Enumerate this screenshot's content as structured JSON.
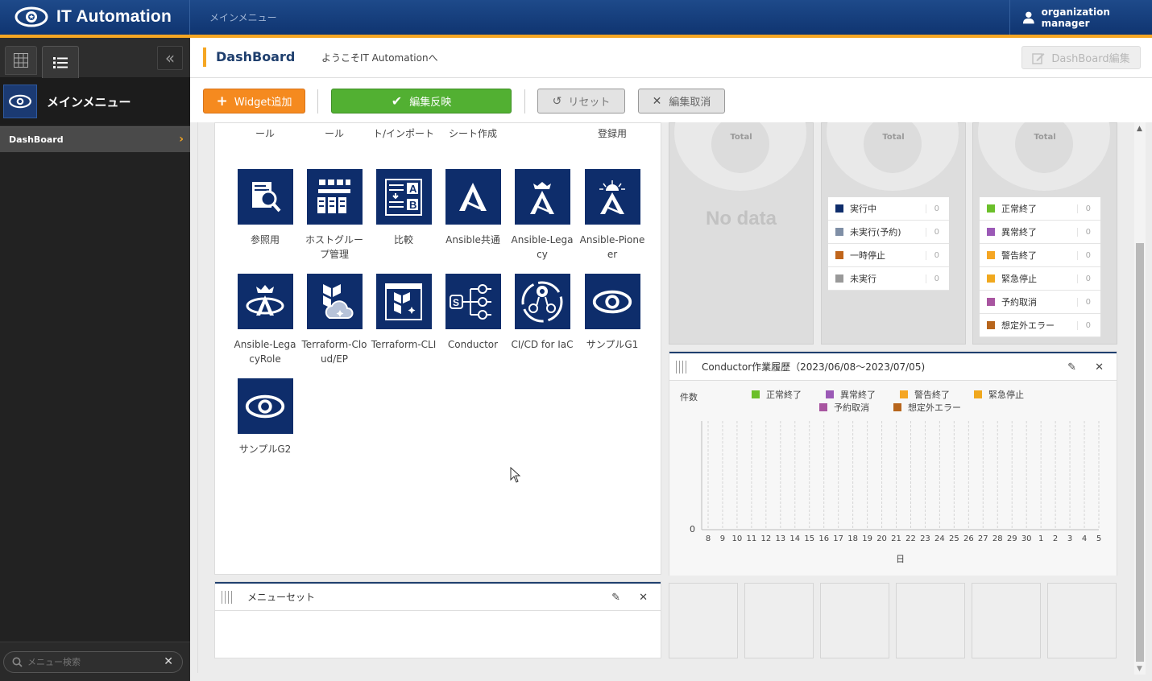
{
  "header": {
    "app_title": "IT Automation",
    "menu_label": "メインメニュー",
    "user": "organization manager"
  },
  "sidebar": {
    "main_menu_label": "メインメニュー",
    "items": [
      {
        "label": "DashBoard",
        "selected": true
      }
    ],
    "search_placeholder": "メニュー検索"
  },
  "page": {
    "title": "DashBoard",
    "welcome": "ようこそIT Automationへ",
    "edit_button": "DashBoard編集"
  },
  "toolbar": {
    "add_widget": "Widget追加",
    "apply": "編集反映",
    "reset": "リセット",
    "cancel": "編集取消"
  },
  "menu_group": {
    "top_row_partial": [
      "ール",
      "ール",
      "ト/インポート",
      "シート作成",
      "",
      "登録用"
    ],
    "items": [
      {
        "label": "参照用",
        "icon": "magnifier-document-icon"
      },
      {
        "label": "ホストグループ管理",
        "icon": "host-group-icon"
      },
      {
        "label": "比較",
        "icon": "compare-ab-icon"
      },
      {
        "label": "Ansible共通",
        "icon": "ansible-icon"
      },
      {
        "label": "Ansible-Legacy",
        "icon": "ansible-legacy-icon"
      },
      {
        "label": "Ansible-Pioneer",
        "icon": "ansible-pioneer-icon"
      },
      {
        "label": "Ansible-LegacyRole",
        "icon": "ansible-legacyrole-icon"
      },
      {
        "label": "Terraform-Cloud/EP",
        "icon": "terraform-cloud-icon"
      },
      {
        "label": "Terraform-CLI",
        "icon": "terraform-cli-icon"
      },
      {
        "label": "Conductor",
        "icon": "conductor-icon"
      },
      {
        "label": "CI/CD for IaC",
        "icon": "cicd-icon"
      },
      {
        "label": "サンプルG1",
        "icon": "ita-logo-icon"
      },
      {
        "label": "サンプルG2",
        "icon": "ita-logo-icon"
      }
    ]
  },
  "pie_widgets": [
    {
      "total_label": "Total",
      "no_data": "No data"
    },
    {
      "total_label": "Total",
      "legend": [
        {
          "label": "実行中",
          "count": "0",
          "color": "#0e2d6b"
        },
        {
          "label": "未実行(予約)",
          "count": "0",
          "color": "#7f8fa6"
        },
        {
          "label": "一時停止",
          "count": "0",
          "color": "#c0651b"
        },
        {
          "label": "未実行",
          "count": "0",
          "color": "#999999"
        }
      ]
    },
    {
      "total_label": "Total",
      "legend": [
        {
          "label": "正常終了",
          "count": "0",
          "color": "#6bbf2a"
        },
        {
          "label": "異常終了",
          "count": "0",
          "color": "#9b59b6"
        },
        {
          "label": "警告終了",
          "count": "0",
          "color": "#f5a623"
        },
        {
          "label": "緊急停止",
          "count": "0",
          "color": "#f0a81e"
        },
        {
          "label": "予約取消",
          "count": "0",
          "color": "#a855a0"
        },
        {
          "label": "想定外エラー",
          "count": "0",
          "color": "#b7651c"
        }
      ]
    }
  ],
  "conductor_history": {
    "title": "Conductor作業履歴（2023/06/08～2023/07/05)",
    "chart_data": {
      "type": "bar",
      "ylabel": "件数",
      "xlabel": "日",
      "categories": [
        "8",
        "9",
        "10",
        "11",
        "12",
        "13",
        "14",
        "15",
        "16",
        "17",
        "18",
        "19",
        "20",
        "21",
        "22",
        "23",
        "24",
        "25",
        "26",
        "27",
        "28",
        "29",
        "30",
        "1",
        "2",
        "3",
        "4",
        "5"
      ],
      "series": [
        {
          "name": "正常終了",
          "color": "#6bbf2a"
        },
        {
          "name": "異常終了",
          "color": "#9b59b6"
        },
        {
          "name": "警告終了",
          "color": "#f5a623"
        },
        {
          "name": "緊急停止",
          "color": "#f0a81e"
        },
        {
          "name": "予約取消",
          "color": "#a855a0"
        },
        {
          "name": "想定外エラー",
          "color": "#b7651c"
        }
      ],
      "yticks": [
        "0"
      ]
    }
  },
  "menu_set": {
    "title": "メニューセット"
  }
}
